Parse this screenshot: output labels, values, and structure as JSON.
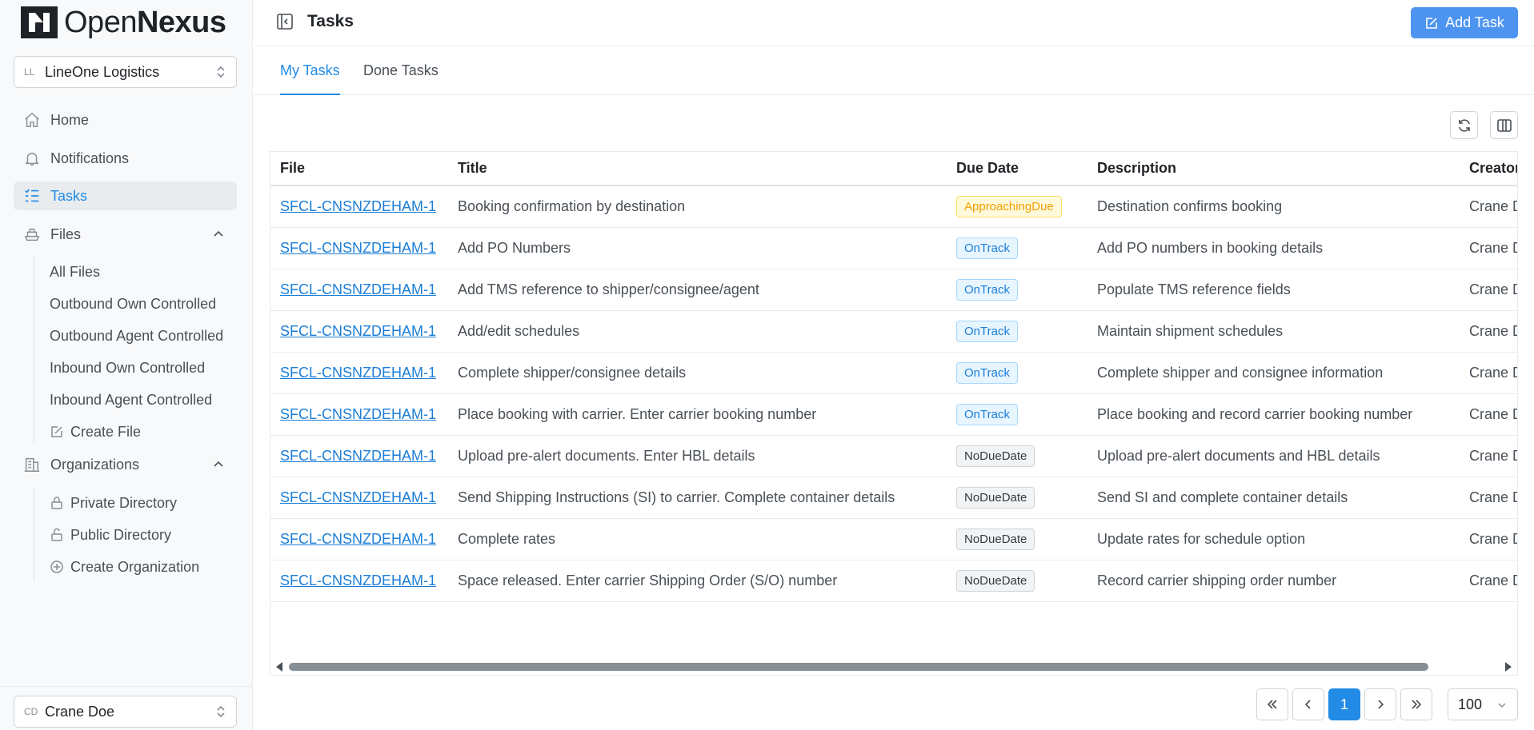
{
  "brand": {
    "name_light": "Open",
    "name_bold": "Nexus"
  },
  "org_selector": {
    "abbr": "LL",
    "name": "LineOne Logistics"
  },
  "nav": {
    "home": "Home",
    "notifications": "Notifications",
    "tasks": "Tasks",
    "files": "Files",
    "files_sub": [
      "All Files",
      "Outbound Own Controlled",
      "Outbound Agent Controlled",
      "Inbound Own Controlled",
      "Inbound Agent Controlled",
      "Create File"
    ],
    "organizations": "Organizations",
    "org_sub": [
      "Private Directory",
      "Public Directory",
      "Create Organization"
    ]
  },
  "user_selector": {
    "abbr": "CD",
    "name": "Crane Doe"
  },
  "header": {
    "title": "Tasks",
    "add_label": "Add Task"
  },
  "tabs": [
    "My Tasks",
    "Done Tasks"
  ],
  "table": {
    "columns": [
      "File",
      "Title",
      "Due Date",
      "Description",
      "Creator"
    ],
    "rows": [
      {
        "file": "SFCL-CNSNZDEHAM-1",
        "title": "Booking confirmation by destination",
        "due": "ApproachingDue",
        "due_kind": "approaching",
        "description": "Destination confirms booking",
        "creator": "Crane Doe"
      },
      {
        "file": "SFCL-CNSNZDEHAM-1",
        "title": "Add PO Numbers",
        "due": "OnTrack",
        "due_kind": "ontrack",
        "description": "Add PO numbers in booking details",
        "creator": "Crane Doe"
      },
      {
        "file": "SFCL-CNSNZDEHAM-1",
        "title": "Add TMS reference to shipper/consignee/agent",
        "due": "OnTrack",
        "due_kind": "ontrack",
        "description": "Populate TMS reference fields",
        "creator": "Crane Doe"
      },
      {
        "file": "SFCL-CNSNZDEHAM-1",
        "title": "Add/edit schedules",
        "due": "OnTrack",
        "due_kind": "ontrack",
        "description": "Maintain shipment schedules",
        "creator": "Crane Doe"
      },
      {
        "file": "SFCL-CNSNZDEHAM-1",
        "title": "Complete shipper/consignee details",
        "due": "OnTrack",
        "due_kind": "ontrack",
        "description": "Complete shipper and consignee information",
        "creator": "Crane Doe"
      },
      {
        "file": "SFCL-CNSNZDEHAM-1",
        "title": "Place booking with carrier. Enter carrier booking number",
        "due": "OnTrack",
        "due_kind": "ontrack",
        "description": "Place booking and record carrier booking number",
        "creator": "Crane Doe"
      },
      {
        "file": "SFCL-CNSNZDEHAM-1",
        "title": "Upload pre-alert documents. Enter HBL details",
        "due": "NoDueDate",
        "due_kind": "nodue",
        "description": "Upload pre-alert documents and HBL details",
        "creator": "Crane Doe"
      },
      {
        "file": "SFCL-CNSNZDEHAM-1",
        "title": "Send Shipping Instructions (SI) to carrier. Complete container details",
        "due": "NoDueDate",
        "due_kind": "nodue",
        "description": "Send SI and complete container details",
        "creator": "Crane Doe"
      },
      {
        "file": "SFCL-CNSNZDEHAM-1",
        "title": "Complete rates",
        "due": "NoDueDate",
        "due_kind": "nodue",
        "description": "Update rates for schedule option",
        "creator": "Crane Doe"
      },
      {
        "file": "SFCL-CNSNZDEHAM-1",
        "title": "Space released. Enter carrier Shipping Order (S/O) number",
        "due": "NoDueDate",
        "due_kind": "nodue",
        "description": "Record carrier shipping order number",
        "creator": "Crane Doe"
      }
    ]
  },
  "pagination": {
    "current_page": "1",
    "page_size": "100"
  },
  "colors": {
    "accent": "#228be6",
    "add_button": "#4d94f0"
  }
}
